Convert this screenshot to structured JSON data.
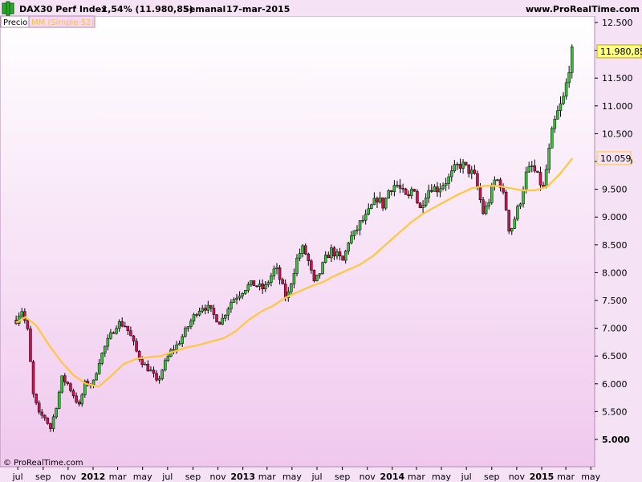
{
  "header": {
    "instrument": "DAX30 Perf Index",
    "change": "-1,54% (11.980,85)",
    "period": "Semanal",
    "date": "17-mar-2015",
    "site": "www.ProRealTime.com"
  },
  "legend": {
    "price_label": "Precio",
    "ma_label": "MM (Simple 52)"
  },
  "copyright": "© ProRealTime.com",
  "price_badge": "11.980,85",
  "ma_badge": "10.059",
  "colors": {
    "background": "#f5e2f5",
    "up_candle": "#38c038",
    "down_candle": "#d01050",
    "ma_line": "#ffc640",
    "price_badge": "#ffff80"
  },
  "chart_data": {
    "type": "candlestick",
    "y_ticks": [
      "12.500",
      "12.000",
      "11.500",
      "11.000",
      "10.500",
      "10.000",
      "9.500",
      "9.000",
      "8.500",
      "8.000",
      "7.500",
      "7.000",
      "6.500",
      "6.000",
      "5.500",
      "5.000"
    ],
    "x_ticks": [
      {
        "label": "jul",
        "year": false
      },
      {
        "label": "sep",
        "year": false
      },
      {
        "label": "nov",
        "year": false
      },
      {
        "label": "2012",
        "year": true
      },
      {
        "label": "mar",
        "year": false
      },
      {
        "label": "may",
        "year": false
      },
      {
        "label": "jul",
        "year": false
      },
      {
        "label": "sep",
        "year": false
      },
      {
        "label": "nov",
        "year": false
      },
      {
        "label": "2013",
        "year": true
      },
      {
        "label": "mar",
        "year": false
      },
      {
        "label": "may",
        "year": false
      },
      {
        "label": "jul",
        "year": false
      },
      {
        "label": "sep",
        "year": false
      },
      {
        "label": "nov",
        "year": false
      },
      {
        "label": "2014",
        "year": true
      },
      {
        "label": "mar",
        "year": false
      },
      {
        "label": "may",
        "year": false
      },
      {
        "label": "jul",
        "year": false
      },
      {
        "label": "sep",
        "year": false
      },
      {
        "label": "nov",
        "year": false
      },
      {
        "label": "2015",
        "year": true
      },
      {
        "label": "mar",
        "year": false
      },
      {
        "label": "may",
        "year": false
      }
    ],
    "ylim": [
      4700,
      12800
    ],
    "close_anchors": [
      [
        "2011-06-27",
        7150
      ],
      [
        "2011-07-10",
        7350
      ],
      [
        "2011-07-25",
        6950
      ],
      [
        "2011-08-08",
        5800
      ],
      [
        "2011-08-22",
        5450
      ],
      [
        "2011-09-05",
        5400
      ],
      [
        "2011-09-19",
        5200
      ],
      [
        "2011-10-03",
        5600
      ],
      [
        "2011-10-17",
        6100
      ],
      [
        "2011-10-31",
        6000
      ],
      [
        "2011-11-14",
        5800
      ],
      [
        "2011-11-28",
        5600
      ],
      [
        "2011-12-12",
        6000
      ],
      [
        "2012-01-01",
        6000
      ],
      [
        "2012-01-15",
        6400
      ],
      [
        "2012-02-01",
        6700
      ],
      [
        "2012-02-15",
        6900
      ],
      [
        "2012-03-01",
        7100
      ],
      [
        "2012-03-20",
        7050
      ],
      [
        "2012-04-05",
        6800
      ],
      [
        "2012-04-20",
        6500
      ],
      [
        "2012-05-10",
        6300
      ],
      [
        "2012-05-25",
        6200
      ],
      [
        "2012-06-05",
        6000
      ],
      [
        "2012-06-20",
        6300
      ],
      [
        "2012-07-10",
        6600
      ],
      [
        "2012-07-25",
        6700
      ],
      [
        "2012-08-10",
        6900
      ],
      [
        "2012-08-25",
        7100
      ],
      [
        "2012-09-10",
        7300
      ],
      [
        "2012-09-25",
        7400
      ],
      [
        "2012-10-10",
        7350
      ],
      [
        "2012-10-25",
        7200
      ],
      [
        "2012-11-08",
        7100
      ],
      [
        "2012-11-20",
        7300
      ],
      [
        "2012-12-05",
        7500
      ],
      [
        "2012-12-20",
        7600
      ],
      [
        "2013-01-10",
        7750
      ],
      [
        "2013-01-25",
        7800
      ],
      [
        "2013-02-08",
        7750
      ],
      [
        "2013-02-22",
        7700
      ],
      [
        "2013-03-08",
        7900
      ],
      [
        "2013-03-22",
        8100
      ],
      [
        "2013-04-05",
        7800
      ],
      [
        "2013-04-18",
        7500
      ],
      [
        "2013-05-01",
        7900
      ],
      [
        "2013-05-15",
        8300
      ],
      [
        "2013-05-29",
        8450
      ],
      [
        "2013-06-10",
        8200
      ],
      [
        "2013-06-24",
        7800
      ],
      [
        "2013-07-08",
        8000
      ],
      [
        "2013-07-22",
        8250
      ],
      [
        "2013-08-05",
        8400
      ],
      [
        "2013-08-20",
        8300
      ],
      [
        "2013-09-03",
        8200
      ],
      [
        "2013-09-17",
        8600
      ],
      [
        "2013-10-01",
        8700
      ],
      [
        "2013-10-15",
        8900
      ],
      [
        "2013-10-29",
        9000
      ],
      [
        "2013-11-12",
        9200
      ],
      [
        "2013-11-26",
        9350
      ],
      [
        "2013-12-10",
        9200
      ],
      [
        "2013-12-24",
        9500
      ],
      [
        "2014-01-10",
        9600
      ],
      [
        "2014-01-25",
        9450
      ],
      [
        "2014-02-08",
        9300
      ],
      [
        "2014-02-22",
        9600
      ],
      [
        "2014-03-08",
        9100
      ],
      [
        "2014-03-22",
        9400
      ],
      [
        "2014-04-05",
        9550
      ],
      [
        "2014-04-20",
        9500
      ],
      [
        "2014-05-05",
        9600
      ],
      [
        "2014-05-20",
        9700
      ],
      [
        "2014-06-05",
        9900
      ],
      [
        "2014-06-20",
        9950
      ],
      [
        "2014-07-05",
        9850
      ],
      [
        "2014-07-20",
        9750
      ],
      [
        "2014-08-01",
        9400
      ],
      [
        "2014-08-12",
        9050
      ],
      [
        "2014-08-25",
        9300
      ],
      [
        "2014-09-10",
        9700
      ],
      [
        "2014-09-22",
        9600
      ],
      [
        "2014-10-05",
        9200
      ],
      [
        "2014-10-15",
        8700
      ],
      [
        "2014-10-28",
        9000
      ],
      [
        "2014-11-10",
        9300
      ],
      [
        "2014-11-25",
        9800
      ],
      [
        "2014-12-08",
        9900
      ],
      [
        "2014-12-20",
        9750
      ],
      [
        "2015-01-05",
        9500
      ],
      [
        "2015-01-15",
        10000
      ],
      [
        "2015-01-28",
        10600
      ],
      [
        "2015-02-10",
        10900
      ],
      [
        "2015-02-22",
        11100
      ],
      [
        "2015-03-05",
        11500
      ],
      [
        "2015-03-13",
        11900
      ],
      [
        "2015-03-17",
        11980
      ]
    ],
    "ma_anchors": [
      [
        "2011-06-27",
        7100
      ],
      [
        "2011-07-20",
        7200
      ],
      [
        "2011-08-15",
        7050
      ],
      [
        "2011-09-15",
        6700
      ],
      [
        "2011-10-15",
        6400
      ],
      [
        "2011-11-15",
        6150
      ],
      [
        "2011-12-15",
        6000
      ],
      [
        "2012-01-15",
        5950
      ],
      [
        "2012-02-15",
        6150
      ],
      [
        "2012-03-15",
        6350
      ],
      [
        "2012-04-15",
        6450
      ],
      [
        "2012-05-15",
        6480
      ],
      [
        "2012-06-15",
        6500
      ],
      [
        "2012-07-15",
        6580
      ],
      [
        "2012-08-15",
        6650
      ],
      [
        "2012-09-15",
        6700
      ],
      [
        "2012-10-15",
        6760
      ],
      [
        "2012-11-15",
        6820
      ],
      [
        "2012-12-15",
        6950
      ],
      [
        "2013-01-15",
        7150
      ],
      [
        "2013-02-15",
        7300
      ],
      [
        "2013-03-15",
        7400
      ],
      [
        "2013-04-15",
        7550
      ],
      [
        "2013-05-15",
        7650
      ],
      [
        "2013-06-15",
        7750
      ],
      [
        "2013-07-15",
        7830
      ],
      [
        "2013-08-15",
        7950
      ],
      [
        "2013-09-15",
        8050
      ],
      [
        "2013-10-15",
        8150
      ],
      [
        "2013-11-15",
        8300
      ],
      [
        "2013-12-15",
        8500
      ],
      [
        "2014-01-15",
        8700
      ],
      [
        "2014-02-15",
        8900
      ],
      [
        "2014-03-15",
        9050
      ],
      [
        "2014-04-15",
        9180
      ],
      [
        "2014-05-15",
        9300
      ],
      [
        "2014-06-15",
        9420
      ],
      [
        "2014-07-15",
        9520
      ],
      [
        "2014-08-15",
        9560
      ],
      [
        "2014-09-15",
        9560
      ],
      [
        "2014-10-15",
        9520
      ],
      [
        "2014-11-15",
        9480
      ],
      [
        "2014-12-15",
        9480
      ],
      [
        "2015-01-15",
        9550
      ],
      [
        "2015-02-15",
        9780
      ],
      [
        "2015-03-17",
        10059
      ]
    ]
  }
}
